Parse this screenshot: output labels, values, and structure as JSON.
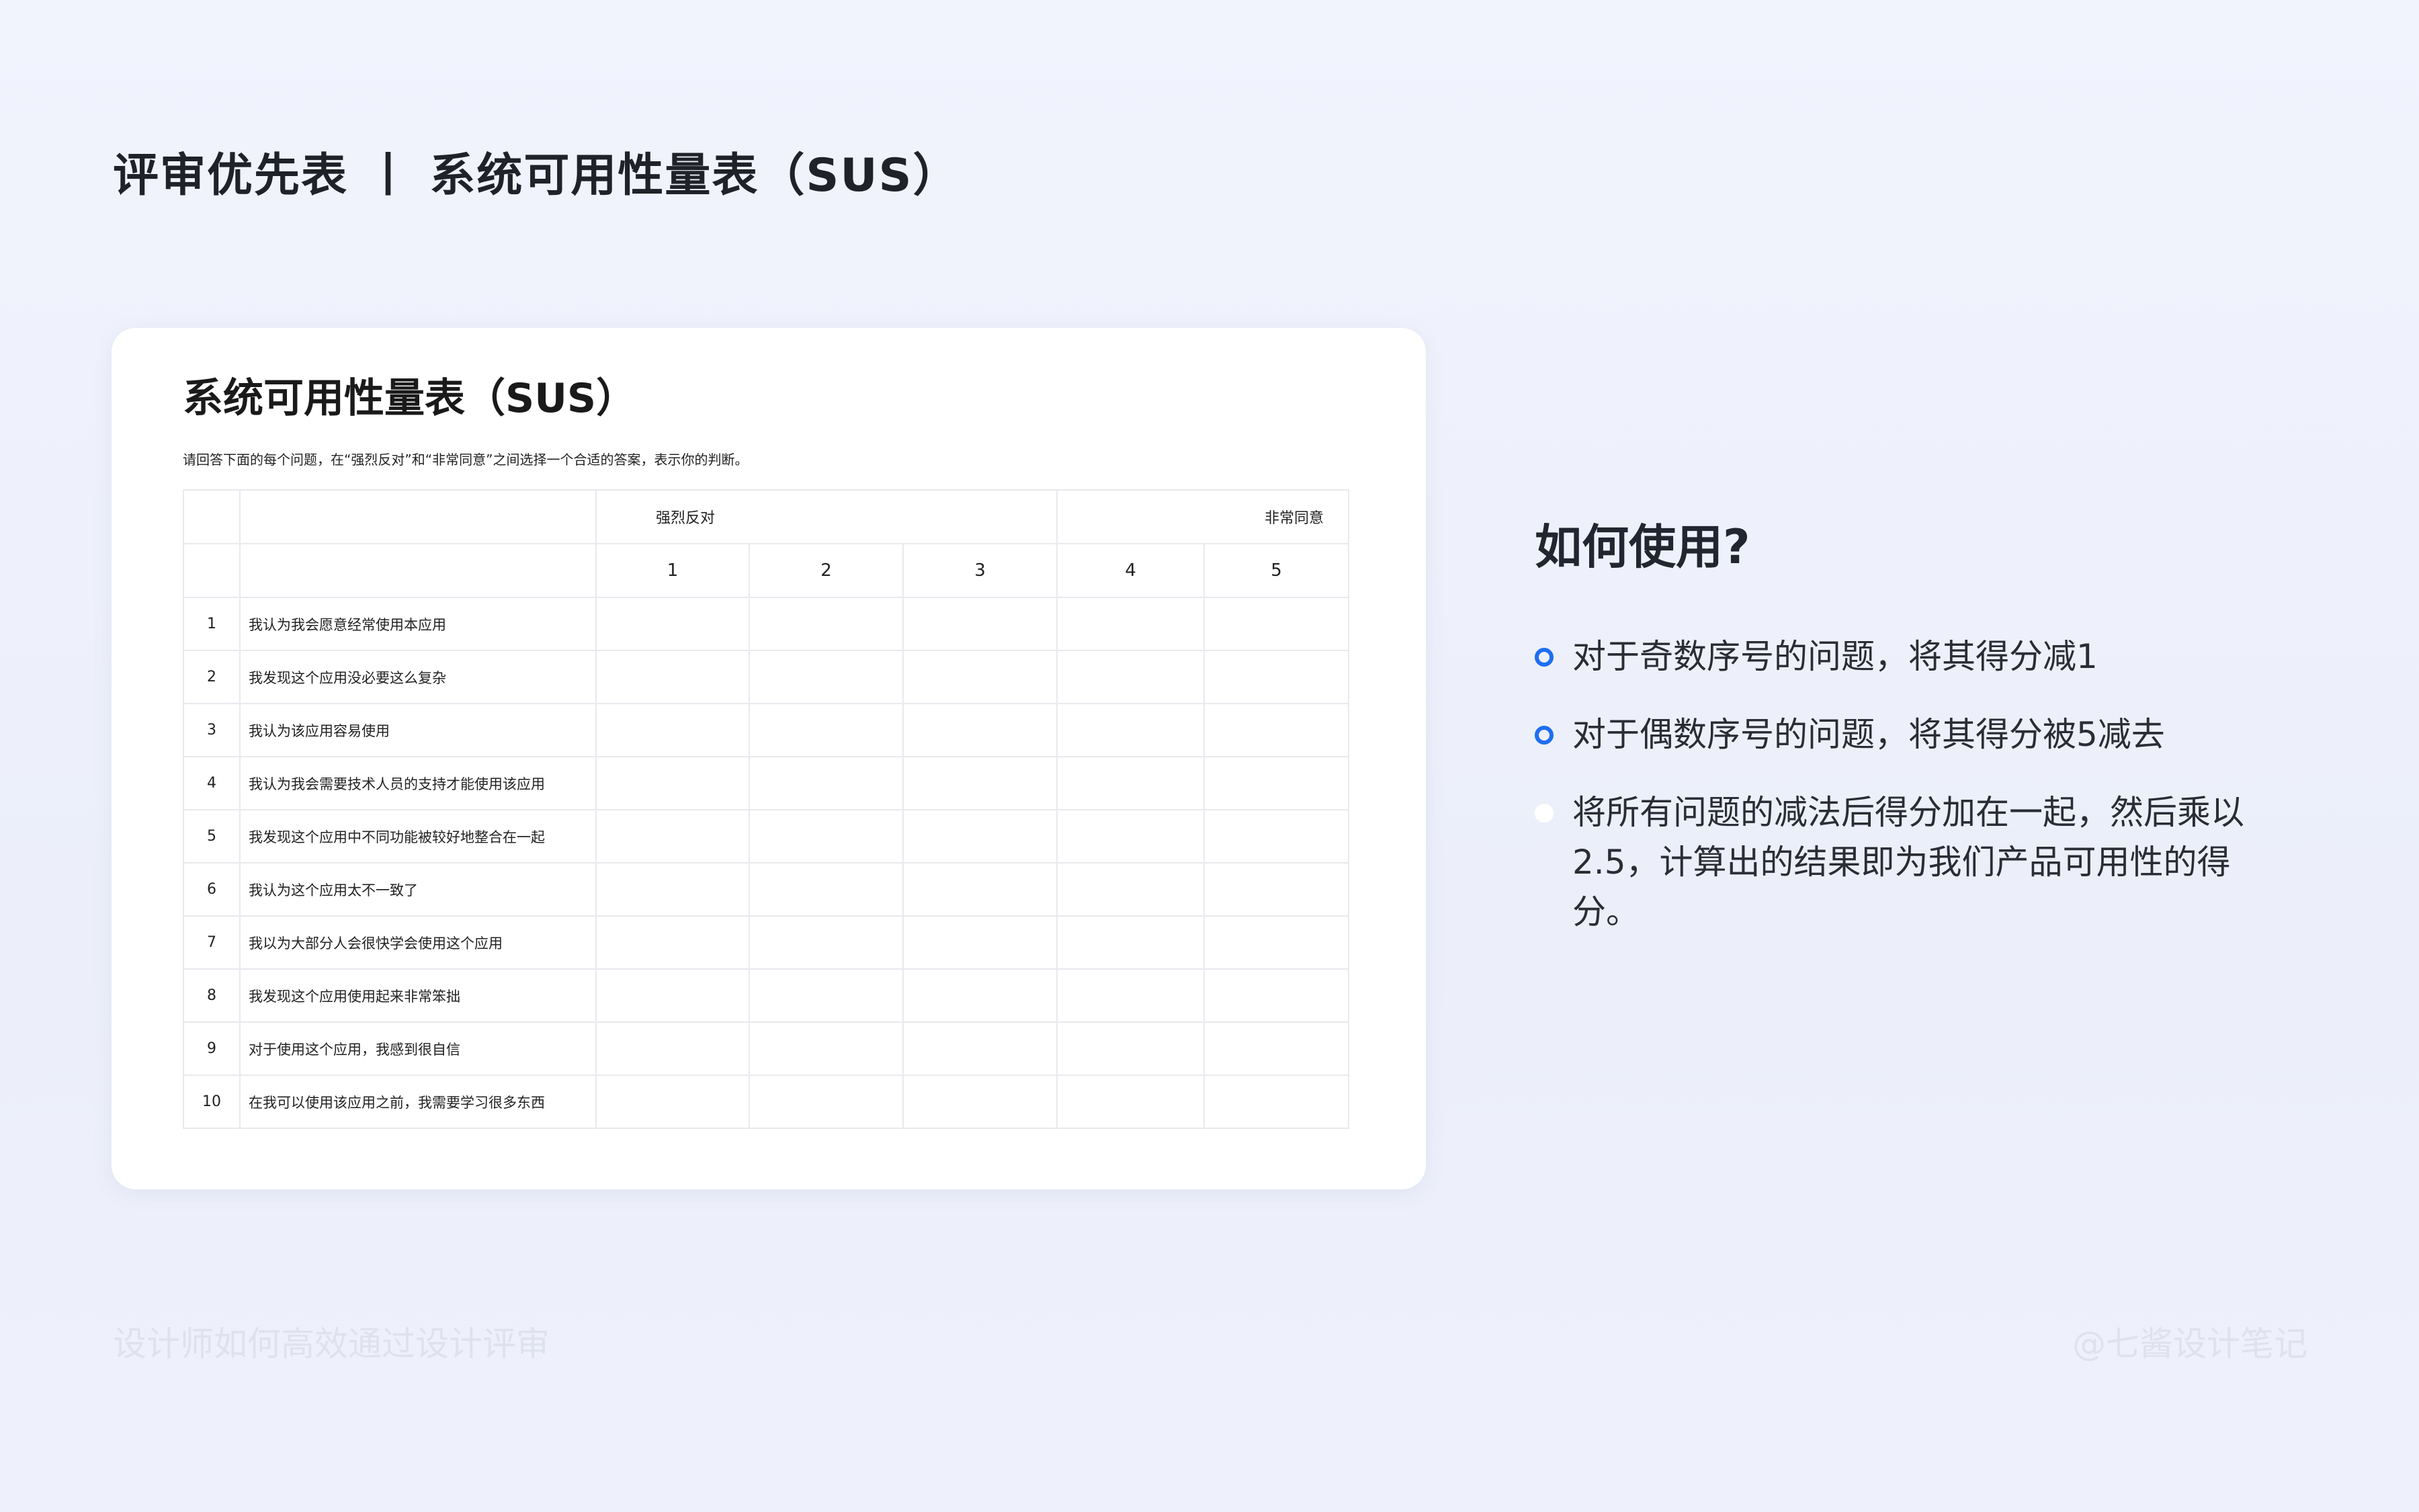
{
  "page": {
    "title": "评审优先表 丨 系统可用性量表（SUS）"
  },
  "card": {
    "title": "系统可用性量表（SUS）",
    "description": "请回答下面的每个问题，在“强烈反对”和“非常同意”之间选择一个合适的答案，表示你的判断。",
    "scale_left_label": "强烈反对",
    "scale_right_label": "非常同意",
    "scale": [
      "1",
      "2",
      "3",
      "4",
      "5"
    ],
    "questions": [
      {
        "num": "1",
        "text": "我认为我会愿意经常使用本应用"
      },
      {
        "num": "2",
        "text": "我发现这个应用没必要这么复杂"
      },
      {
        "num": "3",
        "text": "我认为该应用容易使用"
      },
      {
        "num": "4",
        "text": "我认为我会需要技术人员的支持才能使用该应用"
      },
      {
        "num": "5",
        "text": "我发现这个应用中不同功能被较好地整合在一起"
      },
      {
        "num": "6",
        "text": "我认为这个应用太不一致了"
      },
      {
        "num": "7",
        "text": "我以为大部分人会很快学会使用这个应用"
      },
      {
        "num": "8",
        "text": "我发现这个应用使用起来非常笨拙"
      },
      {
        "num": "9",
        "text": "对于使用这个应用，我感到很自信"
      },
      {
        "num": "10",
        "text": "在我可以使用该应用之前，我需要学习很多东西"
      }
    ]
  },
  "how": {
    "title": "如何使用?",
    "bullets": [
      "对于奇数序号的问题，将其得分减1",
      "对于偶数序号的问题，将其得分被5减去",
      "将所有问题的减法后得分加在一起，然后乘以2.5，计算出的结果即为我们产品可用性的得分。"
    ]
  },
  "footer": {
    "left": "设计师如何高效通过设计评审",
    "right": "@七酱设计笔记"
  },
  "colors": {
    "accent": "#1e6ff0",
    "background": "#eef1fb"
  }
}
